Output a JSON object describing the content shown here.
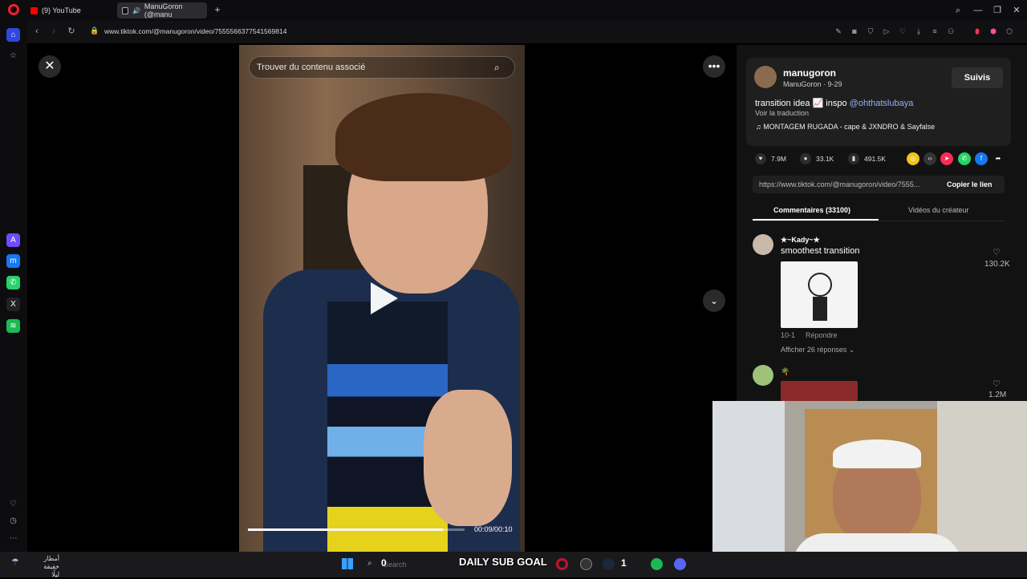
{
  "browser": {
    "tabs": [
      {
        "label": "(9) YouTube",
        "favicon": "youtube-icon"
      },
      {
        "label": "ManuGoron (@manu",
        "favicon": "tiktok-icon",
        "audio": "speaker-icon"
      }
    ],
    "url": "www.tiktok.com/@manugoron/video/7555566377541569814",
    "brand_color": "#ff1b2d"
  },
  "video": {
    "search_placeholder": "Trouver du contenu associé",
    "time": "00:09/00:10",
    "progress": 0.9
  },
  "author": {
    "username": "manugoron",
    "subline": "ManuGoron · 9-29",
    "follow_label": "Suivis"
  },
  "post": {
    "description": "transition idea 📈 inspo ",
    "mention": "@ohthatslubaya",
    "translate": "Voir la traduction",
    "music": "♫  MONTAGEM RUGADA - cape & JXNDRO & Sayfalse",
    "likes": "7.9M",
    "comments": "33.1K",
    "saves": "491.5K",
    "link": "https://www.tiktok.com/@manugoron/video/7555...",
    "copy_label": "Copier le lien"
  },
  "tabs": {
    "comments": "Commentaires (33100)",
    "videos": "Vidéos du créateur"
  },
  "comments": [
    {
      "name": "★~Kady~★",
      "text": "smoothest transition",
      "date": "10-1",
      "reply": "Répondre",
      "more": "Afficher 26 réponses ⌄",
      "likes": "130.2K"
    },
    {
      "name": "🌴",
      "likes": "1.2M"
    }
  ],
  "taskbar": {
    "weather": "أمطار خفيفة",
    "weather_sub": "ليلًا",
    "search": "Search",
    "overlay_count_left": "0",
    "overlay_title": "DAILY SUB GOAL",
    "overlay_count_right": "1"
  }
}
